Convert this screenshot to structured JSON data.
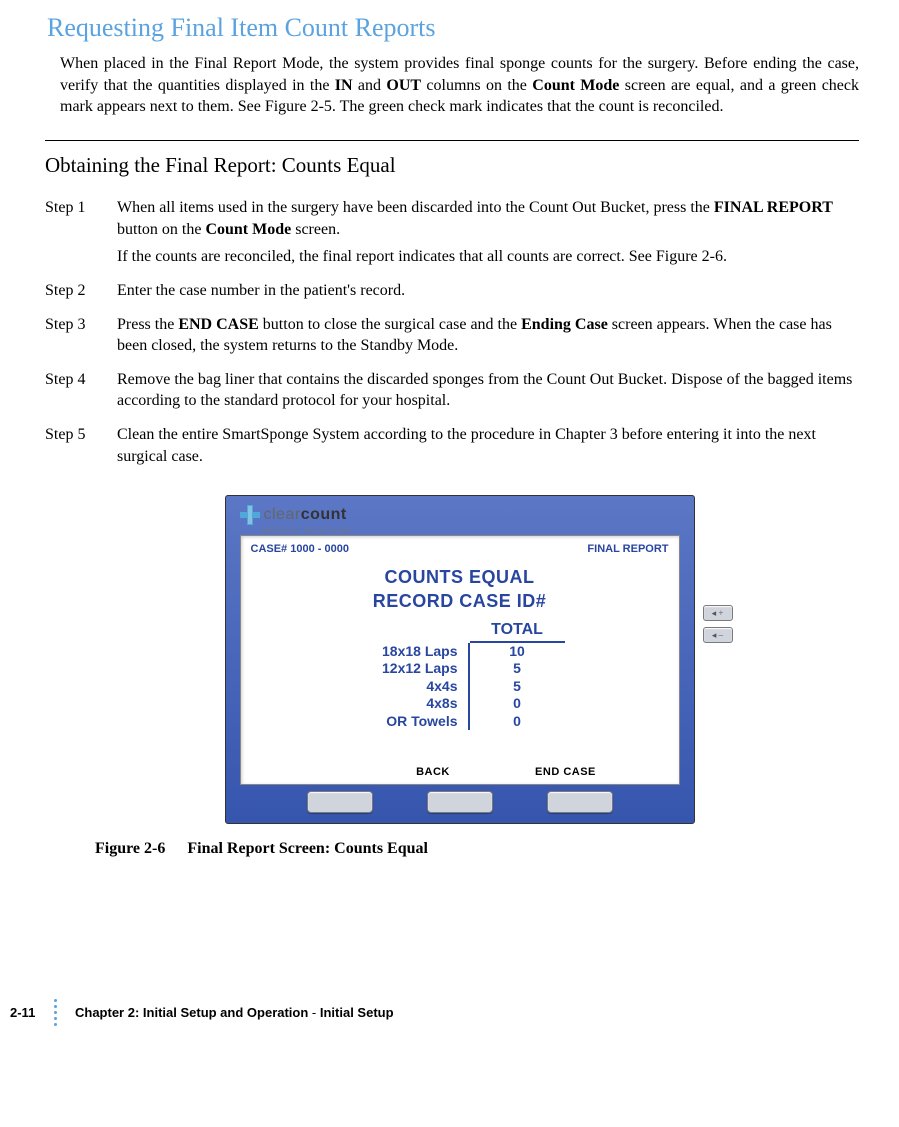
{
  "heading": "Requesting Final Item Count Reports",
  "intro_parts": {
    "p1": "When placed in the Final Report Mode, the system provides final sponge counts for the surgery. Before ending the case, verify that the quantities displayed in the ",
    "b1": "IN",
    "p2": " and ",
    "b2": "OUT",
    "p3": " columns on the ",
    "b3": "Count Mode",
    "p4": " screen are equal, and a green check mark appears next to them. See Figure 2-5. The green check mark indicates that the count is reconciled."
  },
  "subheading": "Obtaining the Final Report: Counts Equal",
  "steps": [
    {
      "label": "Step 1",
      "parts": {
        "t1": "When all items used in the surgery have been discarded into the Count Out Bucket, press the ",
        "b1": "FINAL REPORT",
        "t2": " button on the ",
        "b2": "Count Mode",
        "t3": " screen."
      },
      "sub": "If the counts are reconciled, the final report indicates that all counts are correct. See Figure 2-6."
    },
    {
      "label": "Step 2",
      "parts": {
        "t1": "Enter the case number in the patient's record."
      }
    },
    {
      "label": "Step 3",
      "parts": {
        "t1": "Press the ",
        "b1": "END CASE",
        "t2": " button to close the surgical case and the ",
        "b2": "Ending Case",
        "t3": " screen appears. When the case has been closed, the system returns to the Standby Mode."
      }
    },
    {
      "label": "Step 4",
      "parts": {
        "t1": "Remove the bag liner that contains the discarded sponges from the Count Out Bucket. Dispose of the bagged items according to the standard protocol for your hospital."
      }
    },
    {
      "label": "Step 5",
      "parts": {
        "t1": "Clean the entire SmartSponge System according to the procedure in Chapter 3 before entering it into the next surgical case."
      }
    }
  ],
  "device": {
    "brand_clear": "clear",
    "brand_count": "count",
    "brand_sub": "MEDICAL SOLUTIONS",
    "case_label": "CASE# 1000 - 0000",
    "mode_label": "FINAL REPORT",
    "title1": "COUNTS EQUAL",
    "title2": "RECORD CASE ID#",
    "total_header": "TOTAL",
    "rows": [
      {
        "name": "18x18 Laps",
        "total": "10"
      },
      {
        "name": "12x12 Laps",
        "total": "5"
      },
      {
        "name": "4x4s",
        "total": "5"
      },
      {
        "name": "4x8s",
        "total": "0"
      },
      {
        "name": "OR Towels",
        "total": "0"
      }
    ],
    "btn_back": "BACK",
    "btn_end": "END CASE",
    "vol_up": "◂ +",
    "vol_dn": "◂ –"
  },
  "caption": {
    "fig": "Figure 2-6",
    "title": "Final Report Screen: Counts Equal"
  },
  "footer": {
    "page": "2-11",
    "chapter": "Chapter 2: Initial Setup and Operation",
    "sep": " - ",
    "section": "Initial Setup"
  }
}
